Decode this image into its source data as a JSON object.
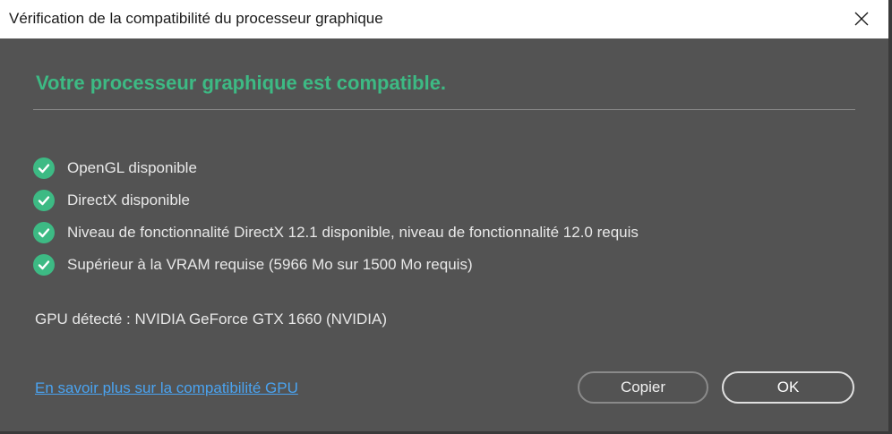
{
  "window": {
    "title": "Vérification de la compatibilité du processeur graphique",
    "close_icon": "close-icon"
  },
  "main": {
    "heading": "Votre processeur graphique est compatible.",
    "checks": [
      {
        "label": "OpenGL disponible",
        "icon": "check-circle-icon"
      },
      {
        "label": "DirectX disponible",
        "icon": "check-circle-icon"
      },
      {
        "label": "Niveau de fonctionnalité DirectX 12.1 disponible, niveau de fonctionnalité 12.0 requis",
        "icon": "check-circle-icon"
      },
      {
        "label": "Supérieur à la VRAM requise (5966 Mo sur 1500 Mo requis)",
        "icon": "check-circle-icon"
      }
    ],
    "gpu_detected": "GPU détecté : NVIDIA GeForce GTX 1660 (NVIDIA)"
  },
  "footer": {
    "learn_more_link": "En savoir plus sur la compatibilité GPU",
    "copy_label": "Copier",
    "ok_label": "OK"
  },
  "colors": {
    "background": "#535353",
    "accent_green": "#3dba84",
    "link_blue": "#4aa3f0",
    "text": "#e8e8e8"
  }
}
